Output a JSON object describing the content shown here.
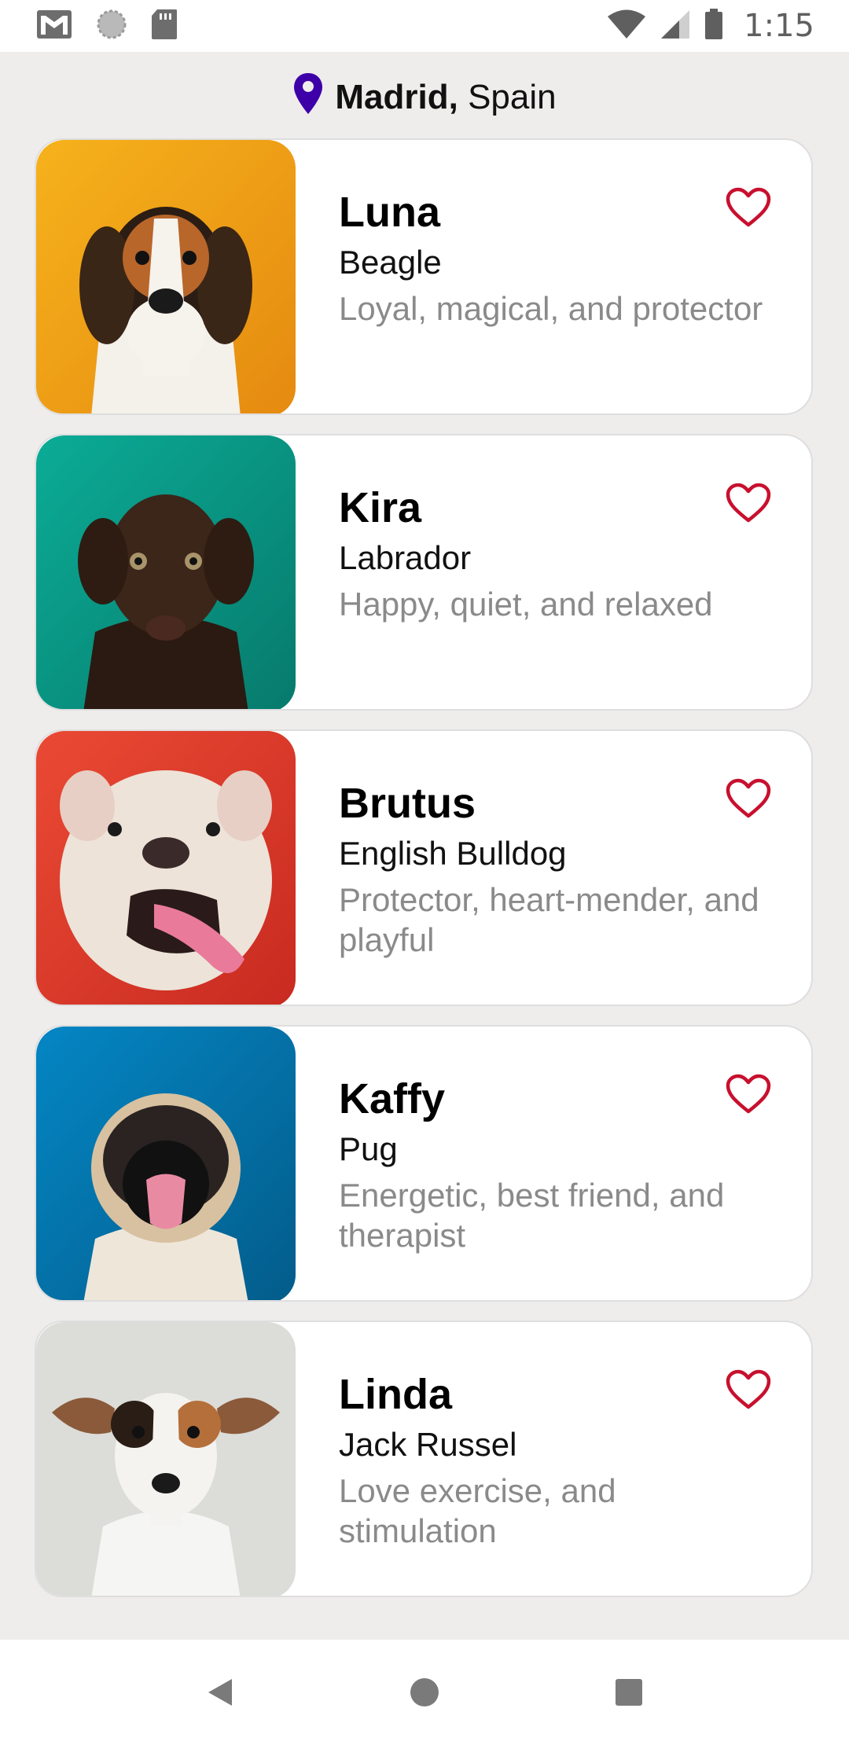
{
  "status_bar": {
    "time": "1:15",
    "icons": [
      "gmail-icon",
      "sync-icon",
      "sd-card-icon",
      "wifi-icon",
      "signal-icon",
      "battery-icon"
    ]
  },
  "location": {
    "city": "Madrid,",
    "country": "Spain",
    "icon": "location-pin-icon",
    "pin_color": "#3d00a8"
  },
  "accent_color": "#c8102e",
  "pets": [
    {
      "name": "Luna",
      "breed": "Beagle",
      "traits": "Loyal, magical, and protector",
      "bg": "#f5a91a"
    },
    {
      "name": "Kira",
      "breed": "Labrador",
      "traits": "Happy, quiet, and relaxed",
      "bg": "#0aa08c"
    },
    {
      "name": "Brutus",
      "breed": "English Bulldog",
      "traits": "Protector, heart-mender, and playful",
      "bg": "#e03a2c"
    },
    {
      "name": "Kaffy",
      "breed": "Pug",
      "traits": "Energetic, best friend, and therapist",
      "bg": "#0377b3"
    },
    {
      "name": "Linda",
      "breed": "Jack Russel",
      "traits": "Love exercise, and stimulation",
      "bg": "#dcdcd8"
    }
  ],
  "nav": {
    "icons": [
      "back-icon",
      "home-icon",
      "recents-icon"
    ]
  }
}
